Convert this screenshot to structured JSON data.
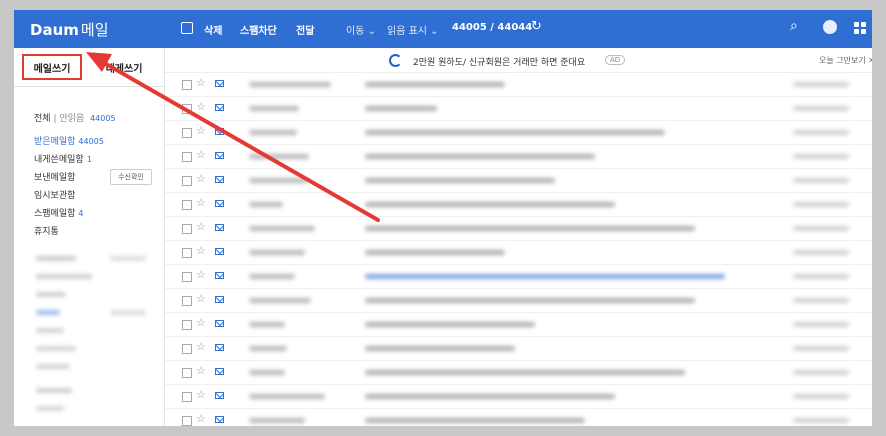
{
  "topbar": {
    "logo": "Daum",
    "logo_sub": "메일",
    "delete": "삭제",
    "block": "스팸차단",
    "forward": "전달",
    "move": "이동 ⌄",
    "read_mark": "읽음 표시 ⌄",
    "count": "44005 / 44044",
    "refresh_icon": "↻",
    "search_icon": "⌕"
  },
  "sidebar": {
    "compose": "메일쓰기",
    "to_me": "내게쓰기",
    "summary_all": "전체",
    "summary_sep": "|",
    "summary_unread": "안읽음",
    "summary_unread_count": "44005",
    "inbox": "받은메일함",
    "inbox_count": "44005",
    "to_me_box": "내게쓴메일함",
    "to_me_count": "1",
    "sent": "보낸메일함",
    "read_confirm": "수신확인",
    "drafts": "임시보관함",
    "spam": "스팸메일함",
    "spam_count": "4",
    "trash": "휴지통"
  },
  "ad": {
    "text": "2만원 원하도/ 신규회원은 거래만 하면 준대요",
    "badge": "AD",
    "close": "오늘 그만보기 ✕"
  },
  "colors": {
    "brand": "#2f6fd3",
    "highlight": "#e53935"
  }
}
